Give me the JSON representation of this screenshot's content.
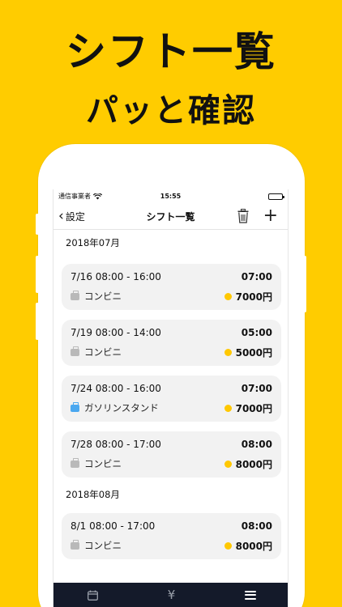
{
  "promo": {
    "headline": "シフト一覧",
    "subheadline": "パッと確認"
  },
  "status_bar": {
    "carrier": "通信事業者",
    "time": "15:55"
  },
  "nav": {
    "back_label": "設定",
    "title": "シフト一覧",
    "delete_icon": "trash-icon",
    "add_label": "+"
  },
  "sections": [
    {
      "label": "2018年07月",
      "shifts": [
        {
          "time_range": "7/16 08:00 - 16:00",
          "duration": "07:00",
          "place": "コンビニ",
          "pay": "7000円",
          "bag_color": "#b9b9b9"
        },
        {
          "time_range": "7/19 08:00 - 14:00",
          "duration": "05:00",
          "place": "コンビニ",
          "pay": "5000円",
          "bag_color": "#b9b9b9"
        },
        {
          "time_range": "7/24 08:00 - 16:00",
          "duration": "07:00",
          "place": "ガソリンスタンド",
          "pay": "7000円",
          "bag_color": "#4aa8f0"
        },
        {
          "time_range": "7/28 08:00 - 17:00",
          "duration": "08:00",
          "place": "コンビニ",
          "pay": "8000円",
          "bag_color": "#b9b9b9"
        }
      ]
    },
    {
      "label": "2018年08月",
      "shifts": [
        {
          "time_range": "8/1 08:00 - 17:00",
          "duration": "08:00",
          "place": "コンビニ",
          "pay": "8000円",
          "bag_color": "#b9b9b9"
        }
      ]
    }
  ],
  "tabbar": {
    "yen_label": "¥",
    "items": [
      "calendar-icon",
      "yen-icon",
      "list-icon"
    ]
  },
  "colors": {
    "background": "#FFCC00",
    "coin": "#FFC800",
    "tabbar": "#141a2a"
  }
}
